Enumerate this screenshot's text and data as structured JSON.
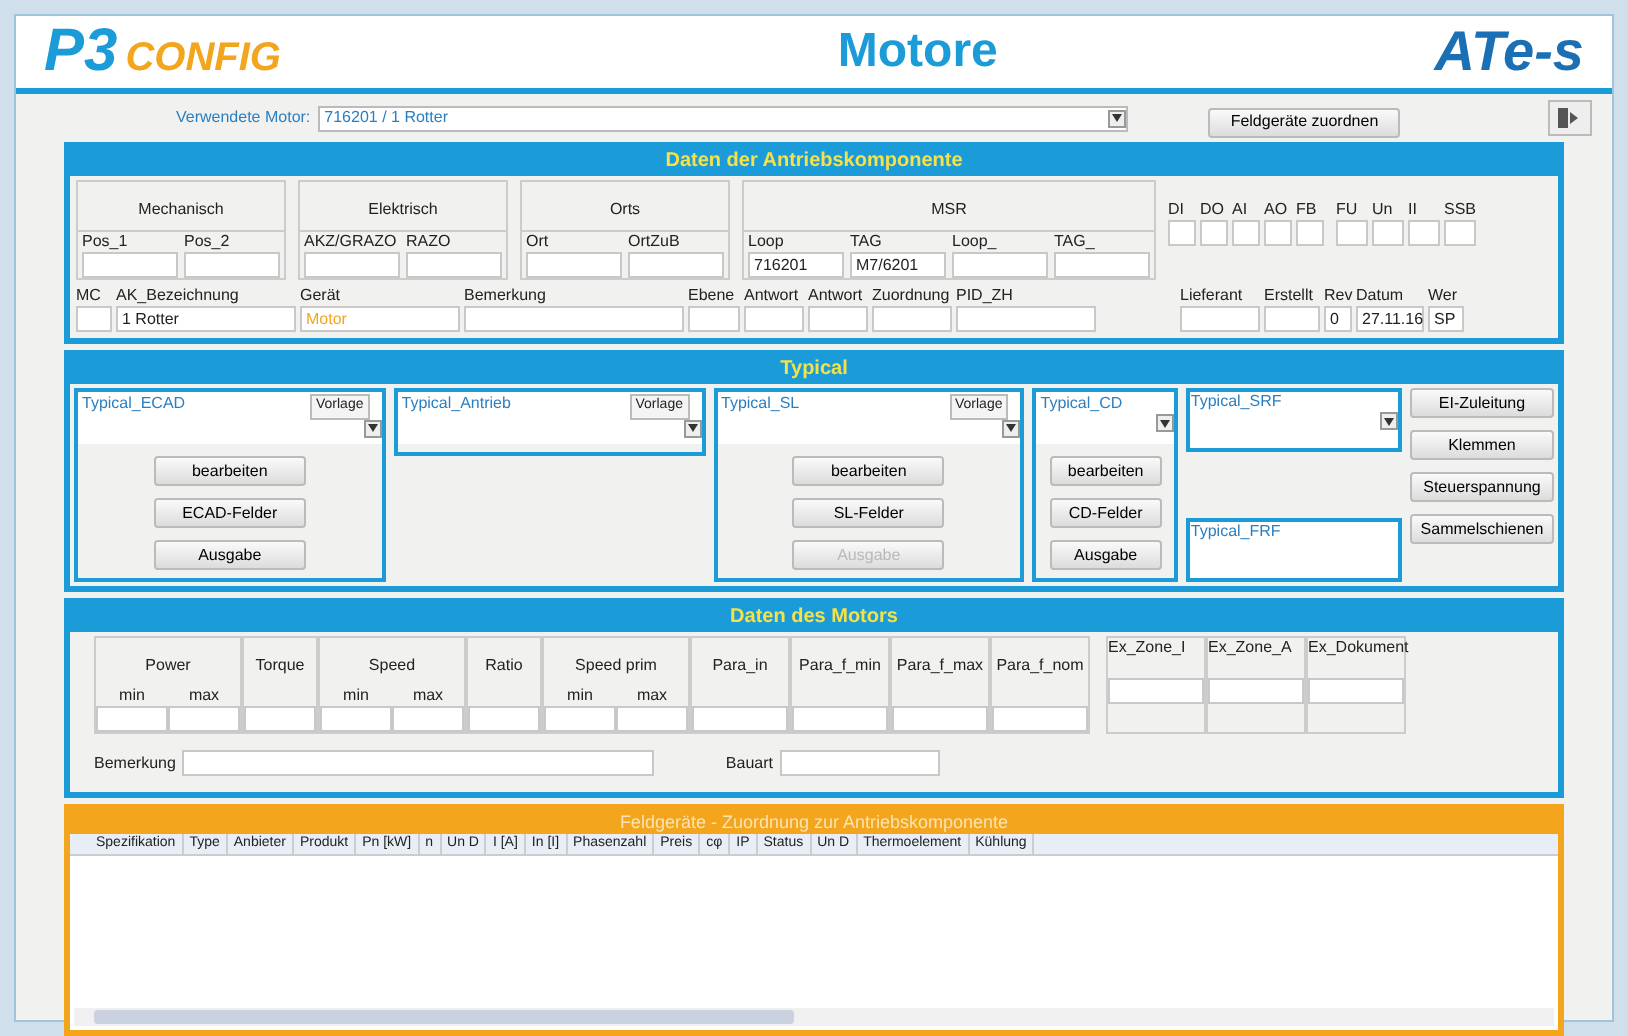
{
  "header": {
    "logo_left": "P3",
    "logo_left_sub": "CONFIG",
    "title": "Motore",
    "logo_right": "ATe-s"
  },
  "motor_select": {
    "label": "Verwendete Motor:",
    "value": "716201 / 1 Rotter",
    "assign_button": "Feldgeräte zuordnen"
  },
  "drive_data": {
    "title": "Daten der Antriebskomponente",
    "groups": [
      {
        "title": "Mechanisch",
        "fields": [
          {
            "label": "Pos_1"
          },
          {
            "label": "Pos_2"
          }
        ]
      },
      {
        "title": "Elektrisch",
        "fields": [
          {
            "label": "AKZ/GRAZO"
          },
          {
            "label": "RAZO"
          }
        ]
      },
      {
        "title": "Orts",
        "fields": [
          {
            "label": "Ort"
          },
          {
            "label": "OrtZuB"
          }
        ]
      },
      {
        "title": "MSR",
        "fields": [
          {
            "label": "Loop",
            "value": "716201"
          },
          {
            "label": "TAG",
            "value": "M7/6201"
          },
          {
            "label": "Loop_"
          },
          {
            "label": "TAG_"
          }
        ]
      }
    ],
    "io": [
      "DI",
      "DO",
      "AI",
      "AO",
      "FB"
    ],
    "extra": [
      "FU",
      "Un",
      "II",
      "SSB"
    ],
    "row2": [
      {
        "label": "MC"
      },
      {
        "label": "AK_Bezeichnung",
        "value": "1 Rotter"
      },
      {
        "label": "Gerät",
        "value": "Motor"
      },
      {
        "label": "Bemerkung"
      },
      {
        "label": "Ebene"
      },
      {
        "label": "Antwort"
      },
      {
        "label": "Antwort"
      },
      {
        "label": "Zuordnung"
      },
      {
        "label": "PID_ZH"
      }
    ],
    "row2_right": [
      {
        "label": "Lieferant"
      },
      {
        "label": "Erstellt"
      },
      {
        "label": "Rev",
        "value": "0"
      },
      {
        "label": "Datum",
        "value": "27.11.16"
      },
      {
        "label": "Wer",
        "value": "SP"
      }
    ]
  },
  "typical": {
    "title": "Typical",
    "boxes": [
      {
        "label": "Typical_ECAD",
        "pick": "Vorlage",
        "buttons": [
          {
            "label": "bearbeiten",
            "disabled": false
          },
          {
            "label": "ECAD-Felder",
            "disabled": false
          },
          {
            "label": "Ausgabe",
            "disabled": false
          }
        ]
      },
      {
        "label": "Typical_Antrieb",
        "pick": "Vorlage"
      },
      {
        "label": "Typical_SL",
        "pick": "Vorlage",
        "buttons": [
          {
            "label": "bearbeiten",
            "disabled": false
          },
          {
            "label": "SL-Felder",
            "disabled": false
          },
          {
            "label": "Ausgabe",
            "disabled": true
          }
        ]
      },
      {
        "label": "Typical_CD",
        "buttons": [
          {
            "label": "bearbeiten",
            "disabled": false
          },
          {
            "label": "CD-Felder",
            "disabled": false
          },
          {
            "label": "Ausgabe",
            "disabled": false
          }
        ]
      }
    ],
    "small_boxes": [
      "Typical_SRF",
      "Typical_FRF"
    ],
    "side_buttons": [
      "EI-Zuleitung",
      "Klemmen",
      "Steuerspannung",
      "Sammelschienen"
    ]
  },
  "motor_data": {
    "title": "Daten des Motors",
    "columns": [
      {
        "label": "Power",
        "sub": [
          "min",
          "max"
        ]
      },
      {
        "label": "Torque"
      },
      {
        "label": "Speed",
        "sub": [
          "min",
          "max"
        ]
      },
      {
        "label": "Ratio"
      },
      {
        "label": "Speed prim",
        "sub": [
          "min",
          "max"
        ]
      },
      {
        "label": "Para_in"
      },
      {
        "label": "Para_f_min"
      },
      {
        "label": "Para_f_max"
      },
      {
        "label": "Para_f_nom"
      }
    ],
    "ex_columns": [
      "Ex_Zone_I",
      "Ex_Zone_A",
      "Ex_Dokument"
    ],
    "remark_label": "Bemerkung",
    "build_label": "Bauart"
  },
  "field_devices": {
    "title": "Feldgeräte - Zuordnung zur Antriebskomponente",
    "columns": [
      "Spezifikation",
      "Type",
      "Anbieter",
      "Produkt",
      "Pn [kW]",
      "n",
      "Un D",
      "I [A]",
      "In [I]",
      "Phasenzahl",
      "Preis",
      "cφ",
      "IP",
      "Status",
      "Un D",
      "Thermoelement",
      "Kühlung"
    ]
  }
}
